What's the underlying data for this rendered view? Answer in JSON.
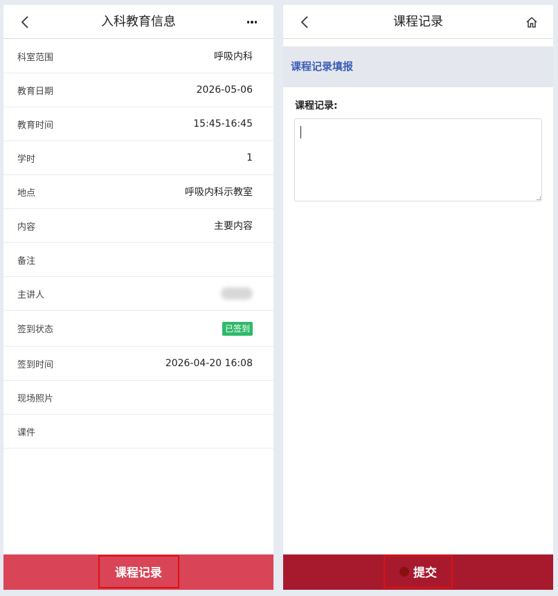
{
  "left": {
    "title": "入科教育信息",
    "rows": [
      {
        "label": "科室范围",
        "value": "呼吸内科"
      },
      {
        "label": "教育日期",
        "value": "2026-05-06"
      },
      {
        "label": "教育时间",
        "value": "15:45-16:45"
      },
      {
        "label": "学时",
        "value": "1"
      },
      {
        "label": "地点",
        "value": "呼吸内科示教室"
      },
      {
        "label": "内容",
        "value": "主要内容"
      },
      {
        "label": "备注",
        "value": ""
      },
      {
        "label": "主讲人",
        "value": ""
      },
      {
        "label": "签到状态",
        "value": "已签到"
      },
      {
        "label": "签到时间",
        "value": "2026-04-20 16:08"
      },
      {
        "label": "现场照片",
        "value": ""
      },
      {
        "label": "课件",
        "value": ""
      }
    ],
    "bottom_button": "课程记录"
  },
  "right": {
    "title": "课程记录",
    "section_title": "课程记录填报",
    "field_label": "课程记录:",
    "textarea_value": "",
    "submit_button": "提交"
  },
  "colors": {
    "left_bar": "#d94456",
    "right_bar": "#a71a2e",
    "badge_green": "#2fb96b",
    "section_blue": "#3a5cb6"
  },
  "icons": {
    "back": "chevron-left-icon",
    "more": "more-dots-icon",
    "home": "home-icon"
  }
}
